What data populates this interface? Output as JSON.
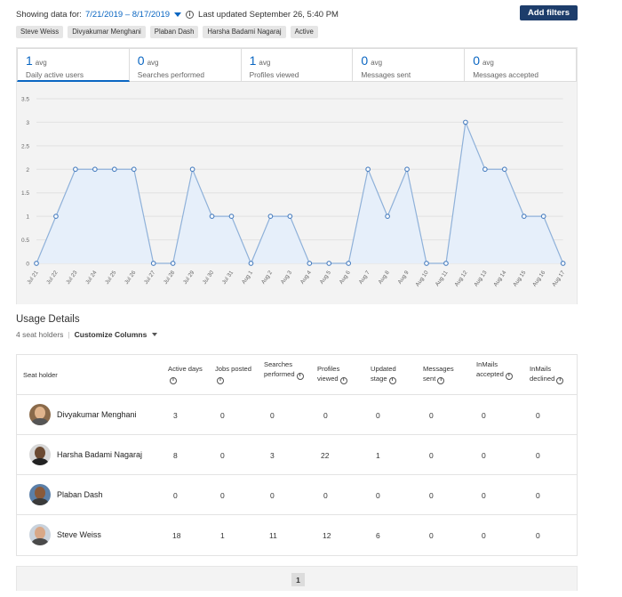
{
  "header": {
    "showing_label": "Showing data for:",
    "date_range": "7/21/2019 – 8/17/2019",
    "updated": "Last updated September 26, 5:40 PM",
    "add_filters": "Add filters"
  },
  "filters": [
    "Steve Weiss",
    "Divyakumar Menghani",
    "Plaban Dash",
    "Harsha Badami Nagaraj",
    "Active"
  ],
  "metrics": [
    {
      "value": "1",
      "avg": "avg",
      "label": "Daily active users"
    },
    {
      "value": "0",
      "avg": "avg",
      "label": "Searches performed"
    },
    {
      "value": "1",
      "avg": "avg",
      "label": "Profiles viewed"
    },
    {
      "value": "0",
      "avg": "avg",
      "label": "Messages sent"
    },
    {
      "value": "0",
      "avg": "avg",
      "label": "Messages accepted"
    }
  ],
  "chart_data": {
    "type": "area",
    "ylim": [
      0,
      3.5
    ],
    "yticks": [
      "0",
      "0.5",
      "1",
      "1.5",
      "2",
      "2.5",
      "3",
      "3.5"
    ],
    "categories": [
      "Jul 21",
      "Jul 22",
      "Jul 23",
      "Jul 24",
      "Jul 25",
      "Jul 26",
      "Jul 27",
      "Jul 28",
      "Jul 29",
      "Jul 30",
      "Jul 31",
      "Aug 1",
      "Aug 2",
      "Aug 3",
      "Aug 4",
      "Aug 5",
      "Aug 6",
      "Aug 7",
      "Aug 8",
      "Aug 9",
      "Aug 10",
      "Aug 11",
      "Aug 12",
      "Aug 13",
      "Aug 14",
      "Aug 15",
      "Aug 16",
      "Aug 17"
    ],
    "values": [
      0,
      1,
      2,
      2,
      2,
      2,
      0,
      0,
      2,
      1,
      1,
      0,
      1,
      1,
      0,
      0,
      0,
      2,
      1,
      2,
      0,
      0,
      3,
      2,
      2,
      1,
      1,
      0
    ],
    "grid": true,
    "colors": {
      "line": "#8fb1d9",
      "fill": "#e6effa",
      "point": "#4a7fc0"
    }
  },
  "usage": {
    "title": "Usage Details",
    "seat_count": "4 seat holders",
    "customize": "Customize Columns"
  },
  "table": {
    "headers": [
      {
        "text": "Seat holder",
        "info": false
      },
      {
        "text": "Active days",
        "info": true
      },
      {
        "text": "Jobs posted",
        "info": true
      },
      {
        "text": "Searches performed",
        "info": true
      },
      {
        "text": "Profiles viewed",
        "info": true
      },
      {
        "text": "Updated stage",
        "info": true
      },
      {
        "text": "Messages sent",
        "info": true
      },
      {
        "text": "InMails accepted",
        "info": true
      },
      {
        "text": "InMails declined",
        "info": true
      }
    ],
    "rows": [
      {
        "name": "Divyakumar Menghani",
        "values": [
          "3",
          "0",
          "0",
          "0",
          "0",
          "0",
          "0",
          "0"
        ]
      },
      {
        "name": "Harsha Badami Nagaraj",
        "values": [
          "8",
          "0",
          "3",
          "22",
          "1",
          "0",
          "0",
          "0"
        ]
      },
      {
        "name": "Plaban Dash",
        "values": [
          "0",
          "0",
          "0",
          "0",
          "0",
          "0",
          "0",
          "0"
        ]
      },
      {
        "name": "Steve Weiss",
        "values": [
          "18",
          "1",
          "11",
          "12",
          "6",
          "0",
          "0",
          "0"
        ]
      }
    ]
  },
  "pagination": {
    "current": "1"
  }
}
